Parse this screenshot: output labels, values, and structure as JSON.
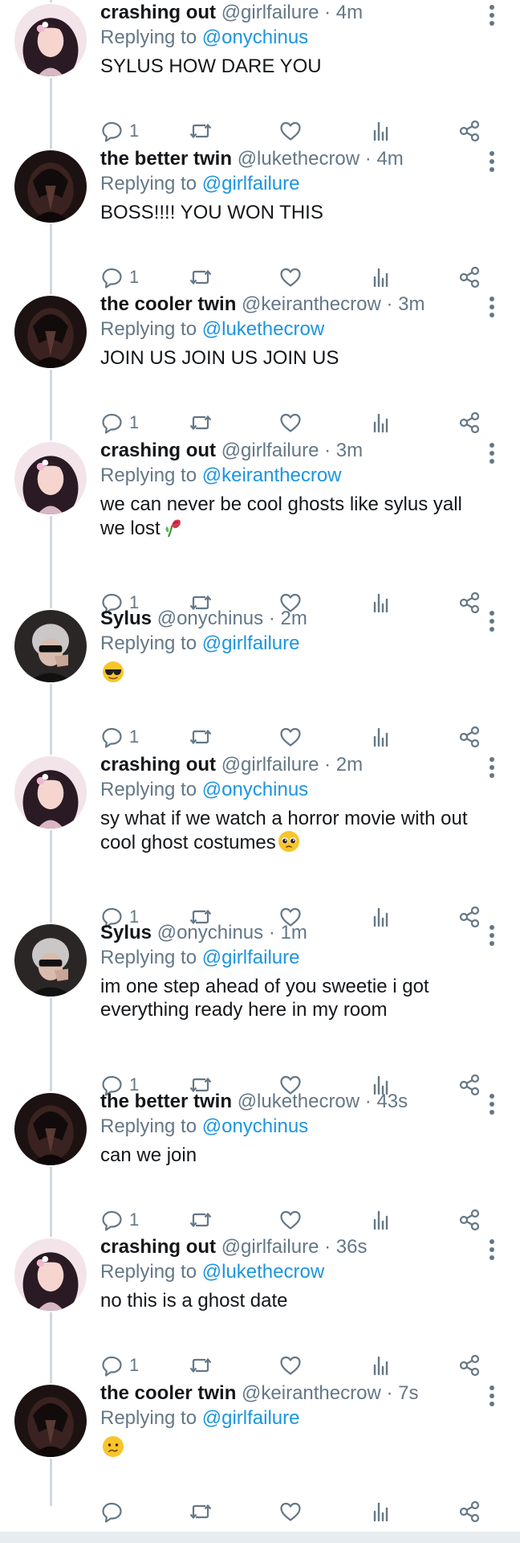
{
  "colors": {
    "link": "#1b95e0",
    "meta": "#657786",
    "text": "#14171a",
    "thread_line": "#cfd9de"
  },
  "tweets": [
    {
      "name": "crashing out",
      "handle": "@girlfailure",
      "time": "· 4m",
      "reply_prefix": "Replying to",
      "reply_to": "@onychinus",
      "text": "SYLUS HOW DARE YOU",
      "emoji": "",
      "reply_count": "1",
      "avatar": "girl-avatar"
    },
    {
      "name": "the better twin",
      "handle": "@lukethecrow",
      "time": "· 4m",
      "reply_prefix": "Replying to",
      "reply_to": "@girlfailure",
      "text": "BOSS!!!! YOU WON THIS",
      "emoji": "",
      "reply_count": "1",
      "avatar": "crow-avatar"
    },
    {
      "name": "the cooler twin",
      "handle": "@keiranthecrow",
      "time": "· 3m",
      "reply_prefix": "Replying to",
      "reply_to": "@lukethecrow",
      "text": "JOIN US JOIN US JOIN US",
      "emoji": "",
      "reply_count": "1",
      "avatar": "crow-avatar"
    },
    {
      "name": "crashing out",
      "handle": "@girlfailure",
      "time": "· 3m",
      "reply_prefix": "Replying to",
      "reply_to": "@keiranthecrow",
      "text": "we can never be cool ghosts like sylus yall we lost",
      "emoji": "wilted-rose-emoji",
      "reply_count": "1",
      "avatar": "girl-avatar"
    },
    {
      "name": "Sylus",
      "handle": "@onychinus",
      "time": "· 2m",
      "reply_prefix": "Replying to",
      "reply_to": "@girlfailure",
      "text": "",
      "emoji": "sunglasses-emoji",
      "reply_count": "1",
      "avatar": "sylus-avatar"
    },
    {
      "name": "crashing out",
      "handle": "@girlfailure",
      "time": "· 2m",
      "reply_prefix": "Replying to",
      "reply_to": "@onychinus",
      "text": "sy what if we watch a horror movie with out cool ghost costumes",
      "emoji": "pleading-emoji",
      "reply_count": "1",
      "avatar": "girl-avatar"
    },
    {
      "name": "Sylus",
      "handle": "@onychinus",
      "time": "· 1m",
      "reply_prefix": "Replying to",
      "reply_to": "@girlfailure",
      "text": "im one step ahead of you sweetie i got everything ready here in my room",
      "emoji": "",
      "reply_count": "1",
      "avatar": "sylus-avatar"
    },
    {
      "name": "the better twin",
      "handle": "@lukethecrow",
      "time": "· 43s",
      "reply_prefix": "Replying to",
      "reply_to": "@onychinus",
      "text": "can we join",
      "emoji": "",
      "reply_count": "1",
      "avatar": "crow-avatar"
    },
    {
      "name": "crashing out",
      "handle": "@girlfailure",
      "time": "· 36s",
      "reply_prefix": "Replying to",
      "reply_to": "@lukethecrow",
      "text": "no this is a ghost date",
      "emoji": "",
      "reply_count": "1",
      "avatar": "girl-avatar"
    },
    {
      "name": "the cooler twin",
      "handle": "@keiranthecrow",
      "time": "· 7s",
      "reply_prefix": "Replying to",
      "reply_to": "@girlfailure",
      "text": "",
      "emoji": "confused-emoji",
      "reply_count": "",
      "avatar": "crow-avatar"
    }
  ]
}
